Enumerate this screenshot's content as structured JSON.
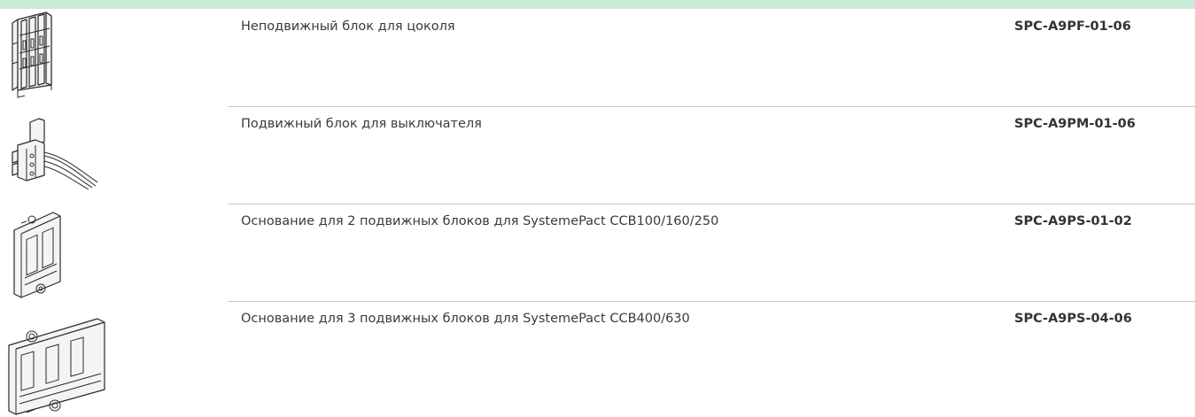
{
  "products": [
    {
      "description": "Неподвижный блок для цоколя",
      "reference": "SPC-A9PF-01-06",
      "image_icon": "fixed-block-icon"
    },
    {
      "description": "Подвижный блок для выключателя",
      "reference": "SPC-A9PM-01-06",
      "image_icon": "moving-block-icon"
    },
    {
      "description": "Основание для 2 подвижных блоков для SystemePact CCB100/160/250",
      "reference": "SPC-A9PS-01-02",
      "image_icon": "support-2-blocks-icon"
    },
    {
      "description": "Основание для 3 подвижных блоков для SystemePact CCB400/630",
      "reference": "SPC-A9PS-04-06",
      "image_icon": "support-3-blocks-icon"
    }
  ],
  "colors": {
    "top_bar": "#c9e9d9",
    "separator": "#c8c8c8",
    "text": "#3a3a3a"
  }
}
